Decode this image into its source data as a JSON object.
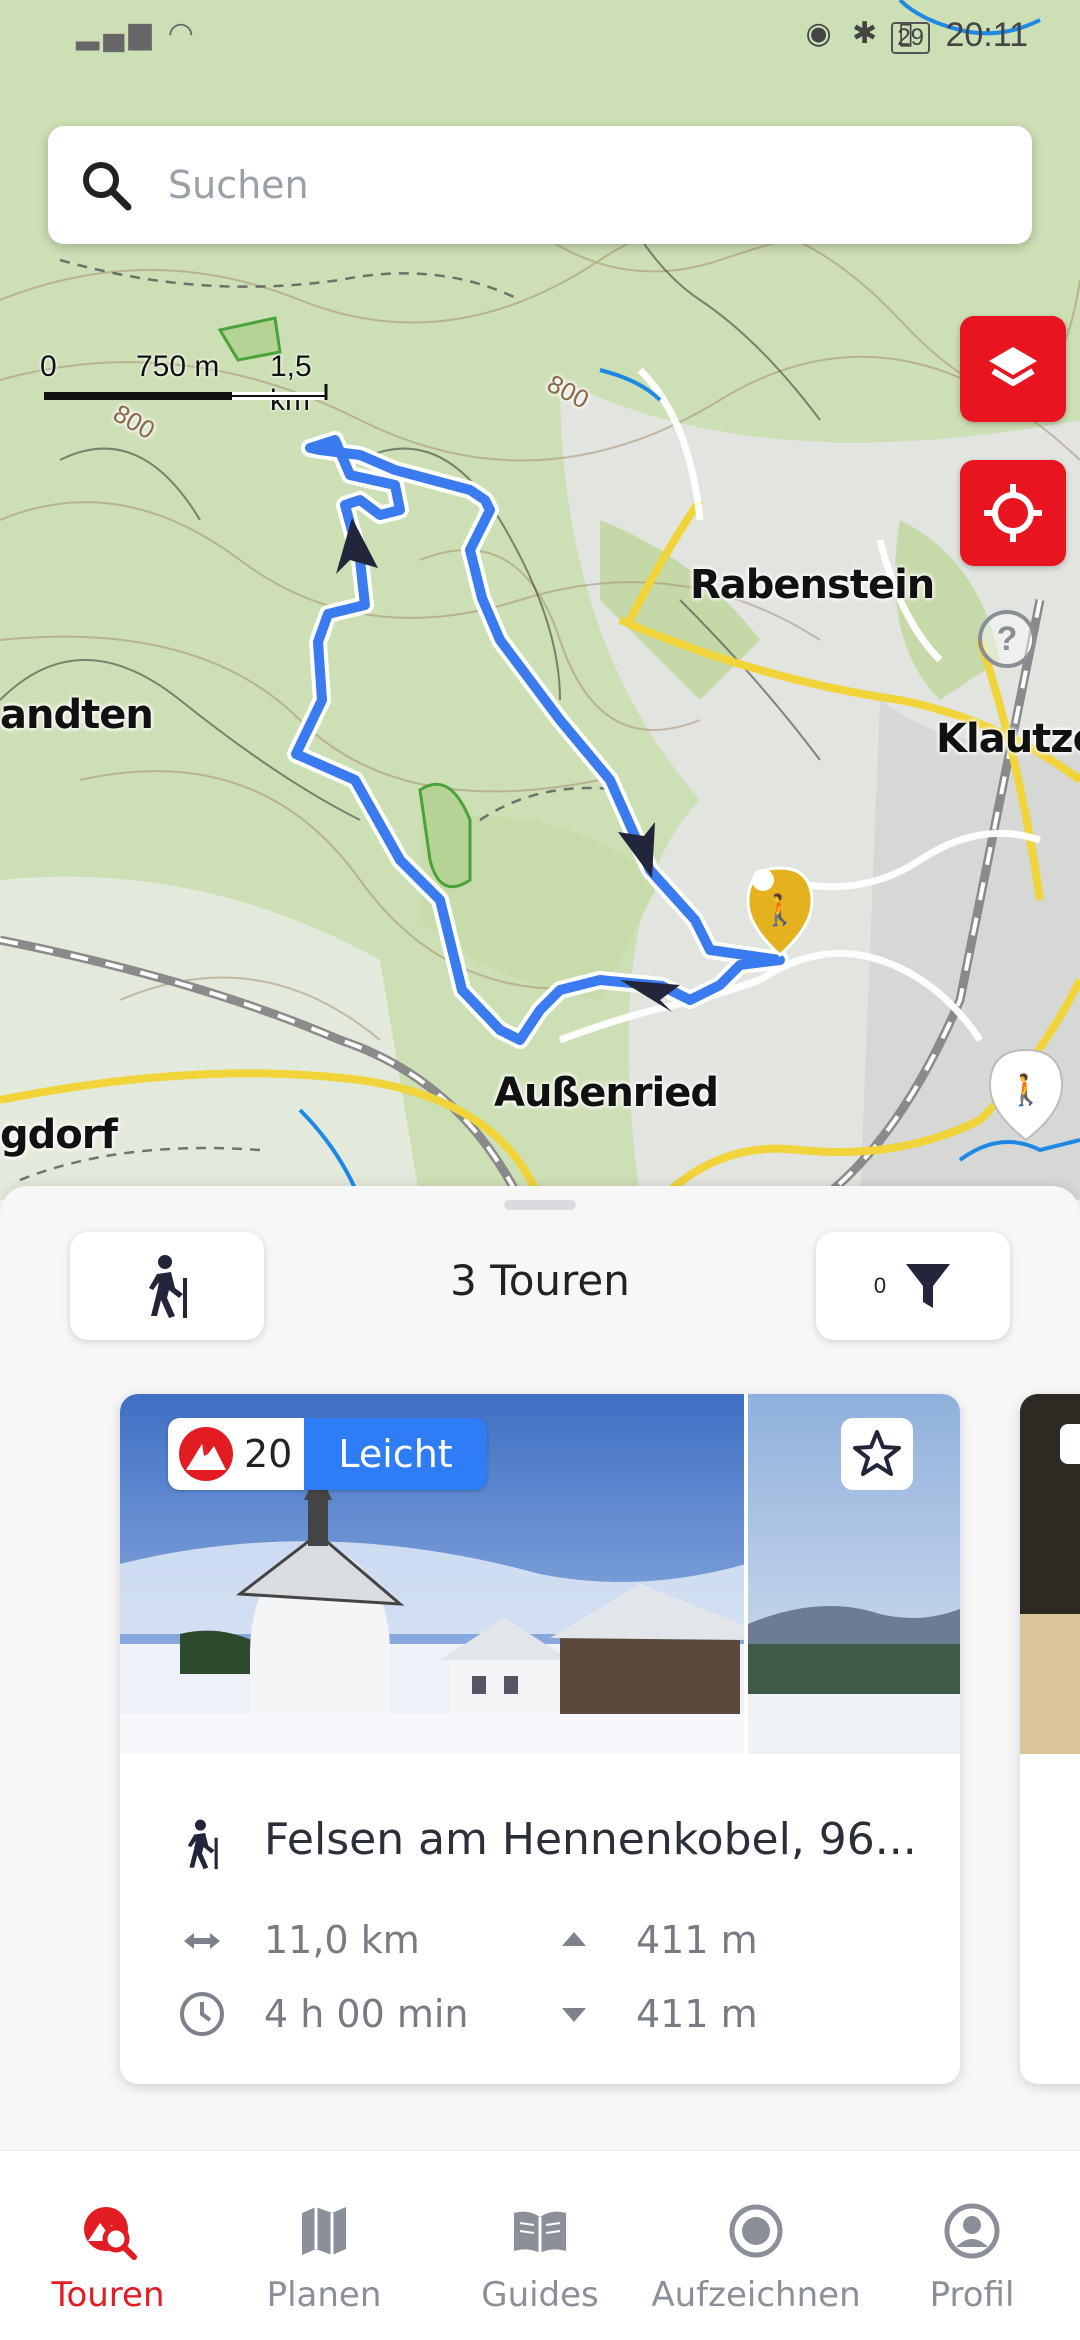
{
  "status_bar": {
    "time": "20:11",
    "battery": "29"
  },
  "search": {
    "placeholder": "Suchen"
  },
  "map": {
    "scale": {
      "zero": "0",
      "mid": "750 m",
      "end": "1,5 km"
    },
    "labels": {
      "rabenstein": "Rabenstein",
      "klautzen": "Klautzen",
      "brandten": "andten",
      "aussenried": "Außenried",
      "gdorf": "gdorf",
      "contour_800a": "800",
      "contour_800b": "800"
    },
    "buttons": {
      "layers_icon": "layers-icon",
      "locate_icon": "crosshair-icon",
      "help": "?"
    },
    "colors": {
      "route": "#3a7bf0",
      "accent": "#e8141f"
    }
  },
  "sheet": {
    "tours_count": "3 Touren",
    "filter_count": "0"
  },
  "tour_card": {
    "rating": "20",
    "difficulty": "Leicht",
    "title": "Felsen am Hennenkobel, 96...",
    "distance": "11,0 km",
    "duration": "4 h 00 min",
    "ascent": "411 m",
    "descent": "411 m"
  },
  "nav": {
    "items": [
      {
        "label": "Touren",
        "icon": "tour-search-icon",
        "active": true
      },
      {
        "label": "Planen",
        "icon": "map-icon",
        "active": false
      },
      {
        "label": "Guides",
        "icon": "book-icon",
        "active": false
      },
      {
        "label": "Aufzeichnen",
        "icon": "record-icon",
        "active": false
      },
      {
        "label": "Profil",
        "icon": "profile-icon",
        "active": false
      }
    ]
  }
}
